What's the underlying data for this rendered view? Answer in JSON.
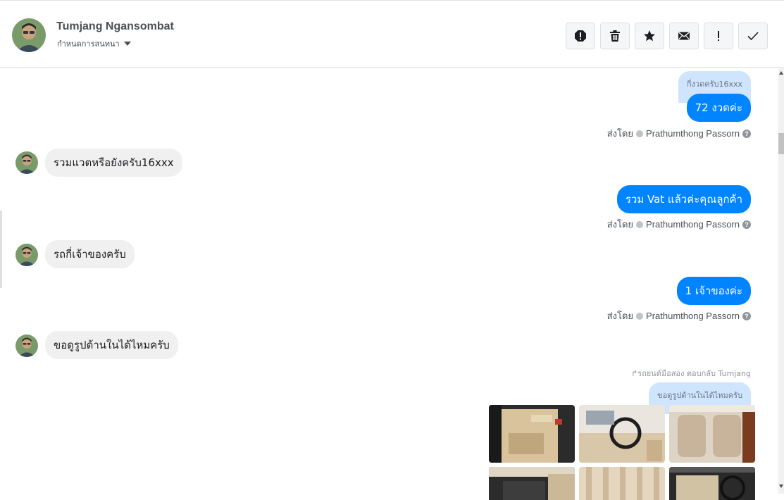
{
  "header": {
    "contact_name": "Tumjang Ngansombat",
    "contact_sub": "กำหนดการสนทนา"
  },
  "action_buttons": [
    {
      "name": "report-icon"
    },
    {
      "name": "trash-icon"
    },
    {
      "name": "star-icon"
    },
    {
      "name": "mail-icon"
    },
    {
      "name": "important-icon"
    },
    {
      "name": "check-icon"
    }
  ],
  "messages": {
    "quote_1": "กี่งวดครับ16xxx",
    "out_1": "72 งวดค่ะ",
    "sent_by_label": "ส่งโดย",
    "agent_name": "Prathumthong Passorn",
    "in_1": "รวมแวตหรือยังครับ16xxx",
    "out_2": "รวม Vat แล้วค่ะคุณลูกค้า",
    "in_2": "รถกี่เจ้าของครับ",
    "out_3": "1 เจ้าของค่ะ",
    "in_3": "ขอดูรูปด้านในได้ไหมครับ",
    "reply_note": "รถยนต์มือสอง ตอบกลับ Tumjang",
    "quote_2": "ขอดูรูปด้านในได้ไหมครับ"
  },
  "colors": {
    "outgoing_bubble": "#0084ff",
    "incoming_bubble": "#f1f0f0",
    "quote_bubble": "#cfe5fd"
  }
}
